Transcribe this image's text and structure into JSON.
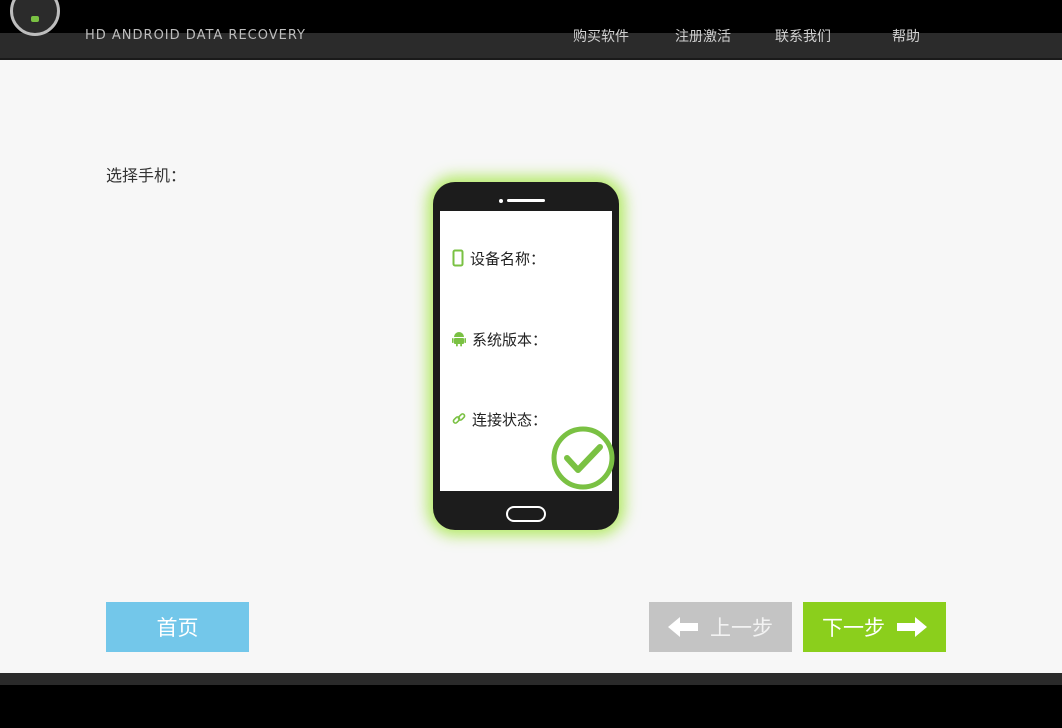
{
  "header": {
    "app_name": "HD ANDROID DATA RECOVERY",
    "nav": [
      "购买软件",
      "注册激活",
      "联系我们",
      "帮助"
    ]
  },
  "main": {
    "select_label": "选择手机：",
    "device": {
      "name_label": "设备名称：",
      "version_label": "系统版本：",
      "status_label": "连接状态：",
      "status_icon": "check-circle-icon"
    }
  },
  "buttons": {
    "home": "首页",
    "prev": "上一步",
    "next": "下一步"
  },
  "colors": {
    "accent_green": "#8bcf1c",
    "home_blue": "#73c7ea",
    "disabled_gray": "#c4c4c4"
  }
}
